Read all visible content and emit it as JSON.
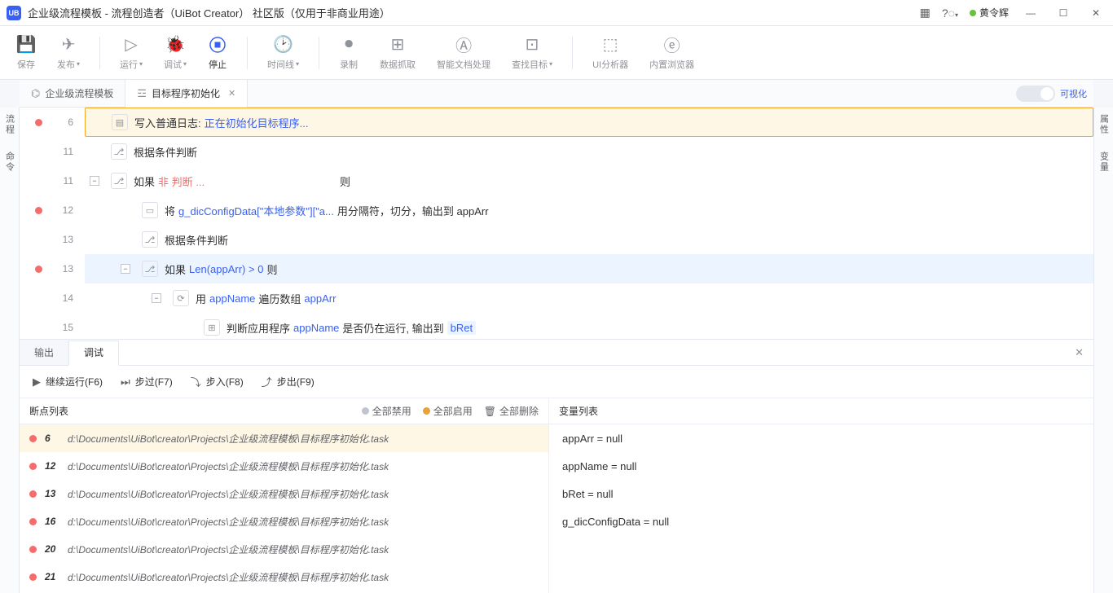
{
  "titlebar": {
    "title": "企业级流程模板 - 流程创造者（UiBot Creator）  社区版（仅用于非商业用途）",
    "user": "黄令辉"
  },
  "toolbar": {
    "save": "保存",
    "publish": "发布",
    "run": "运行",
    "debug": "调试",
    "stop": "停止",
    "timeline": "时间线",
    "record": "录制",
    "capture": "数据抓取",
    "doc": "智能文档处理",
    "find": "查找目标",
    "uianalyzer": "UI分析器",
    "browser": "内置浏览器"
  },
  "rails": {
    "left_process": "流程",
    "left_cmd": "命令",
    "right_attr": "属性",
    "right_var": "变量"
  },
  "tabs": {
    "t1": "企业级流程模板",
    "t2": "目标程序初始化",
    "visualize": "可视化"
  },
  "code": {
    "rows": [
      {
        "ln": "6",
        "bp": true,
        "indent": 0,
        "icon": "log",
        "hl": true,
        "pre": "写入普通日志: ",
        "kw": "正在初始化目标程序..."
      },
      {
        "ln": "11",
        "bp": false,
        "indent": 0,
        "icon": "cond",
        "pre": "根据条件判断"
      },
      {
        "ln": "11",
        "bp": false,
        "indent": 0,
        "fold": true,
        "icon": "cond",
        "pre": "如果 ",
        "red": "非 判断 ...",
        "post_plain": "则"
      },
      {
        "ln": "12",
        "bp": true,
        "indent": 1,
        "icon": "assign",
        "pre": "将 ",
        "kw": "g_dicConfigData[\"本地参数\"][\"a...",
        "post": " 用分隔符，切分，输出到 appArr"
      },
      {
        "ln": "13",
        "bp": false,
        "indent": 1,
        "icon": "cond",
        "pre": "根据条件判断"
      },
      {
        "ln": "13",
        "bp": true,
        "indent": 1,
        "fold": true,
        "icon": "cond",
        "sel": true,
        "pre": "如果 ",
        "kw": "Len(appArr) > 0",
        "post": " 则"
      },
      {
        "ln": "14",
        "bp": false,
        "indent": 2,
        "fold": true,
        "icon": "loop",
        "pre": "用 ",
        "kw": "appName",
        "mid": " 遍历数组 ",
        "kw2": "appArr"
      },
      {
        "ln": "15",
        "bp": false,
        "indent": 3,
        "icon": "app",
        "pre": "判断应用程序 ",
        "kw": "appName",
        "post": " 是否仍在运行, 输出到 ",
        "chip": "bRet"
      }
    ]
  },
  "bottom": {
    "tab_output": "输出",
    "tab_debug": "调试",
    "continue": "继续运行(F6)",
    "stepover": "步过(F7)",
    "stepin": "步入(F8)",
    "stepout": "步出(F9)",
    "bp_header": "断点列表",
    "disable_all": "全部禁用",
    "enable_all": "全部启用",
    "delete_all": "全部删除",
    "var_header": "变量列表",
    "breakpoints": [
      {
        "ln": "6",
        "path": "d:\\Documents\\UiBot\\creator\\Projects\\企业级流程模板\\目标程序初始化.task",
        "sel": true
      },
      {
        "ln": "12",
        "path": "d:\\Documents\\UiBot\\creator\\Projects\\企业级流程模板\\目标程序初始化.task"
      },
      {
        "ln": "13",
        "path": "d:\\Documents\\UiBot\\creator\\Projects\\企业级流程模板\\目标程序初始化.task"
      },
      {
        "ln": "16",
        "path": "d:\\Documents\\UiBot\\creator\\Projects\\企业级流程模板\\目标程序初始化.task"
      },
      {
        "ln": "20",
        "path": "d:\\Documents\\UiBot\\creator\\Projects\\企业级流程模板\\目标程序初始化.task"
      },
      {
        "ln": "21",
        "path": "d:\\Documents\\UiBot\\creator\\Projects\\企业级流程模板\\目标程序初始化.task"
      }
    ],
    "variables": [
      "appArr = null",
      "appName = null",
      "bRet = null",
      "g_dicConfigData = null"
    ]
  }
}
